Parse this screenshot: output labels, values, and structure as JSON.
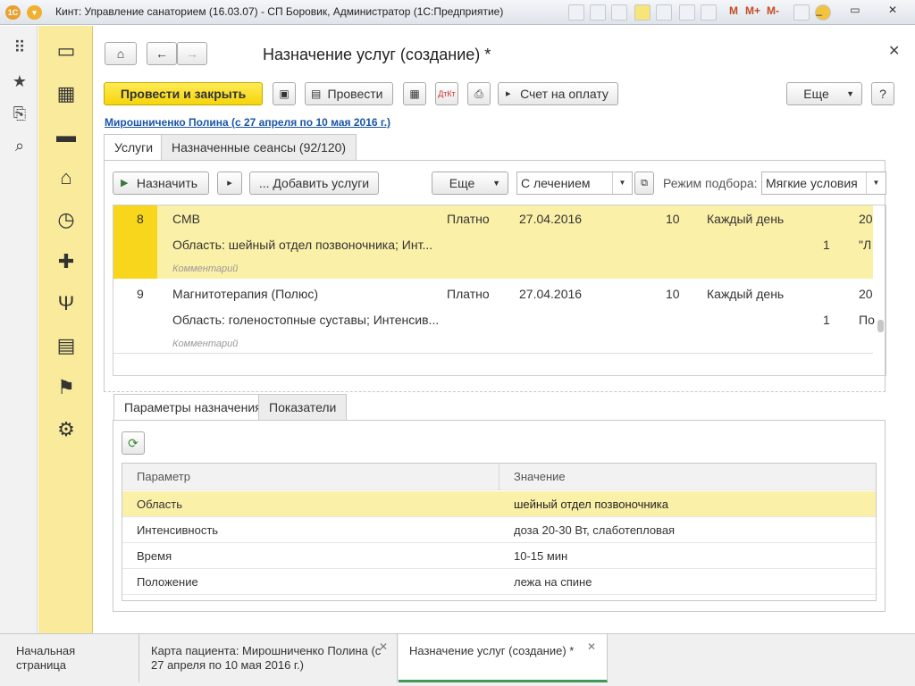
{
  "window": {
    "title": "Кинт: Управление санаторием (16.03.07) - СП Боровик, Администратор   (1С:Предприятие)"
  },
  "form": {
    "title": "Назначение услуг (создание) *"
  },
  "toolbar": {
    "post_close": "Провести и закрыть",
    "post": "Провести",
    "invoice": "Счет на оплату",
    "more": "Еще",
    "help": "?"
  },
  "patient_link": "Мирошниченко Полина (с 27 апреля по 10 мая 2016 г.)",
  "tabs": [
    "Услуги",
    "Назначенные сеансы (92/120)"
  ],
  "services_toolbar": {
    "assign": "Назначить",
    "add_services": "... Добавить услуги",
    "more": "Еще",
    "treatment_filter": "С лечением",
    "mode_label": "Режим подбора:",
    "mode_value": "Мягкие условия"
  },
  "services": [
    {
      "num": "8",
      "name": "СМВ",
      "area": "Область: шейный отдел позвоночника; Инт...",
      "comment": "Комментарий",
      "payment": "Платно",
      "date": "27.04.2016",
      "count": "10",
      "freq": "Каждый день",
      "count2": "1",
      "col_a": "20",
      "col_b": "\"Л"
    },
    {
      "num": "9",
      "name": "Магнитотерапия (Полюс)",
      "area": "Область: голеностопные суставы; Интенсив...",
      "comment": "Комментарий",
      "payment": "Платно",
      "date": "27.04.2016",
      "count": "10",
      "freq": "Каждый день",
      "count2": "1",
      "col_a": "20",
      "col_b": "По"
    }
  ],
  "param_tabs": [
    "Параметры назначения",
    "Показатели"
  ],
  "params_table": {
    "headers": [
      "Параметр",
      "Значение"
    ],
    "rows": [
      [
        "Область",
        "шейный отдел позвоночника"
      ],
      [
        "Интенсивность",
        "доза 20-30 Вт, слаботепловая"
      ],
      [
        "Время",
        "10-15 мин"
      ],
      [
        "Положение",
        "лежа на спине"
      ]
    ]
  },
  "bottom_tabs": [
    {
      "label": "Начальная страница"
    },
    {
      "label": "Карта пациента: Мирошниченко Полина (с 27 апреля по 10 мая 2016 г.)"
    },
    {
      "label": "Назначение услуг (создание) *"
    }
  ],
  "colors": {
    "selected_row": "#fbf0a8",
    "section_panel": "#faeb9c",
    "primary_button": "#f5d50a",
    "link": "#1a55a8"
  }
}
